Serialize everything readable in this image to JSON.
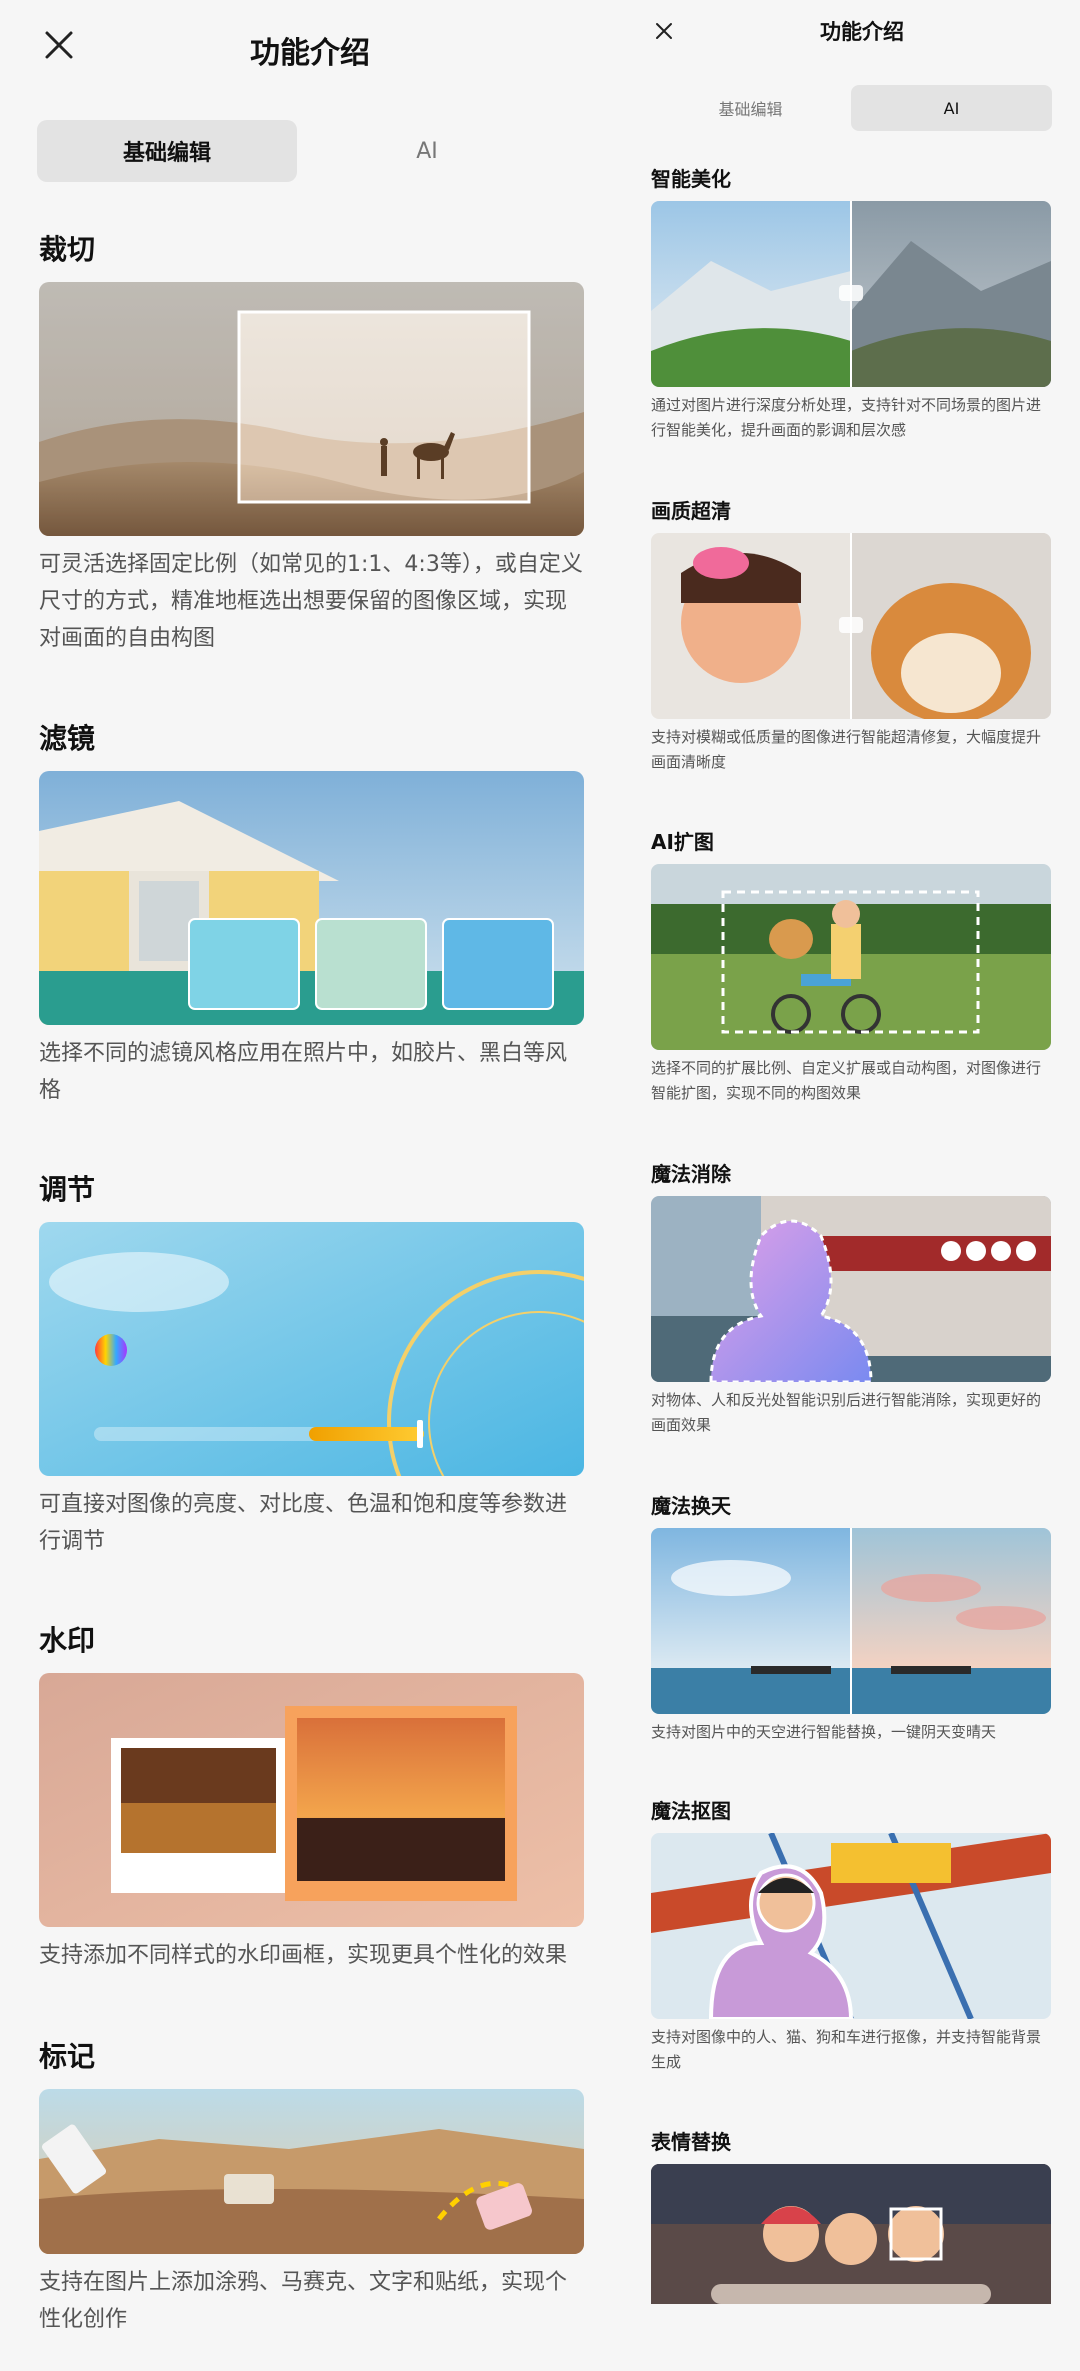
{
  "left": {
    "title": "功能介绍",
    "tabs": [
      {
        "label": "基础编辑",
        "active": true
      },
      {
        "label": "AI",
        "active": false
      }
    ],
    "sections": [
      {
        "title": "裁切",
        "desc": "可灵活选择固定比例（如常见的1:1、4:3等），或自定义尺寸的方式，精准地框选出想要保留的图像区域，实现对画面的自由构图"
      },
      {
        "title": "滤镜",
        "desc": "选择不同的滤镜风格应用在照片中，如胶片、黑白等风格"
      },
      {
        "title": "调节",
        "desc": "可直接对图像的亮度、对比度、色温和饱和度等参数进行调节"
      },
      {
        "title": "水印",
        "desc": "支持添加不同样式的水印画框，实现更具个性化的效果"
      },
      {
        "title": "标记",
        "desc": "支持在图片上添加涂鸦、马赛克、文字和贴纸，实现个性化创作"
      }
    ]
  },
  "right": {
    "title": "功能介绍",
    "tabs": [
      {
        "label": "基础编辑",
        "active": false
      },
      {
        "label": "AI",
        "active": true
      }
    ],
    "sections": [
      {
        "title": "智能美化",
        "desc": "通过对图片进行深度分析处理，支持针对不同场景的图片进行智能美化，提升画面的影调和层次感"
      },
      {
        "title": "画质超清",
        "desc": "支持对模糊或低质量的图像进行智能超清修复，大幅度提升画面清晰度"
      },
      {
        "title": "AI扩图",
        "desc": "选择不同的扩展比例、自定义扩展或自动构图，对图像进行智能扩图，实现不同的构图效果"
      },
      {
        "title": "魔法消除",
        "desc": "对物体、人和反光处智能识别后进行智能消除，实现更好的画面效果"
      },
      {
        "title": "魔法换天",
        "desc": "支持对图片中的天空进行智能替换，一键阴天变晴天"
      },
      {
        "title": "魔法抠图",
        "desc": "支持对图像中的人、猫、狗和车进行抠像，并支持智能背景生成"
      },
      {
        "title": "表情替换",
        "desc": ""
      }
    ]
  }
}
